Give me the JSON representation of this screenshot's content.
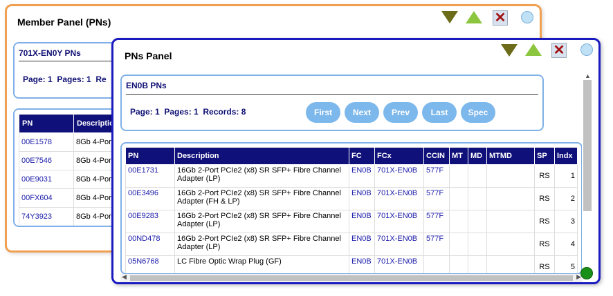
{
  "member_panel": {
    "title": "Member Panel (PNs)",
    "info": {
      "title": "701X-EN0Y PNs",
      "page_stats": "Page: 1  Pages: 1  Re"
    },
    "columns": [
      "PN",
      "Descriptio"
    ],
    "rows": [
      {
        "pn": "00E1578",
        "desc": "8Gb 4-Port"
      },
      {
        "pn": "00E7546",
        "desc": "8Gb 4-Port"
      },
      {
        "pn": "00E9031",
        "desc": "8Gb 4-Port"
      },
      {
        "pn": "00FX604",
        "desc": "8Gb 4-Port"
      },
      {
        "pn": "74Y3923",
        "desc": "8Gb 4-Port"
      }
    ]
  },
  "pns_panel": {
    "title": "PNs Panel",
    "info": {
      "title": "EN0B PNs",
      "page_stats": "Page: 1  Pages: 1  Records: 8"
    },
    "buttons": {
      "first": "First",
      "next": "Next",
      "prev": "Prev",
      "last": "Last",
      "spec": "Spec"
    },
    "columns": [
      "PN",
      "Description",
      "FC",
      "FCx",
      "CCIN",
      "MT",
      "MD",
      "MTMD",
      "SP",
      "Indx"
    ],
    "rows": [
      {
        "pn": "00E1731",
        "desc": "16Gb 2-Port PCIe2 (x8) SR SFP+ Fibre Channel Adapter (LP)",
        "fc": "EN0B",
        "fcx": "701X-EN0B",
        "ccin": "577F",
        "mt": "",
        "md": "",
        "mtmd": "",
        "sp": "RS",
        "indx": "1"
      },
      {
        "pn": "00E3496",
        "desc": "16Gb 2-Port PCIe2 (x8) SR SFP+ Fibre Channel Adapter (FH & LP)",
        "fc": "EN0B",
        "fcx": "701X-EN0B",
        "ccin": "577F",
        "mt": "",
        "md": "",
        "mtmd": "",
        "sp": "RS",
        "indx": "2"
      },
      {
        "pn": "00E9283",
        "desc": "16Gb 2-Port PCIe2 (x8) SR SFP+ Fibre Channel Adapter (LP)",
        "fc": "EN0B",
        "fcx": "701X-EN0B",
        "ccin": "577F",
        "mt": "",
        "md": "",
        "mtmd": "",
        "sp": "RS",
        "indx": "3"
      },
      {
        "pn": "00ND478",
        "desc": "16Gb 2-Port PCIe2 (x8) SR SFP+ Fibre Channel Adapter (LP)",
        "fc": "EN0B",
        "fcx": "701X-EN0B",
        "ccin": "577F",
        "mt": "",
        "md": "",
        "mtmd": "",
        "sp": "RS",
        "indx": "4"
      },
      {
        "pn": "05N6768",
        "desc": "LC Fibre Optic Wrap Plug (GF)",
        "fc": "EN0B",
        "fcx": "701X-EN0B",
        "ccin": "",
        "mt": "",
        "md": "",
        "mtmd": "",
        "sp": "RS",
        "indx": "5"
      }
    ]
  },
  "icons": {
    "minimize": "triangle-down-icon",
    "maximize": "triangle-up-icon",
    "close": "close-x-icon",
    "circle": "circle-icon",
    "status": "green-dot-icon"
  },
  "colors": {
    "member_border": "#f0a050",
    "pns_border": "#1a1ac0",
    "header_bg": "#10107a",
    "button_bg": "#7db8ec"
  }
}
